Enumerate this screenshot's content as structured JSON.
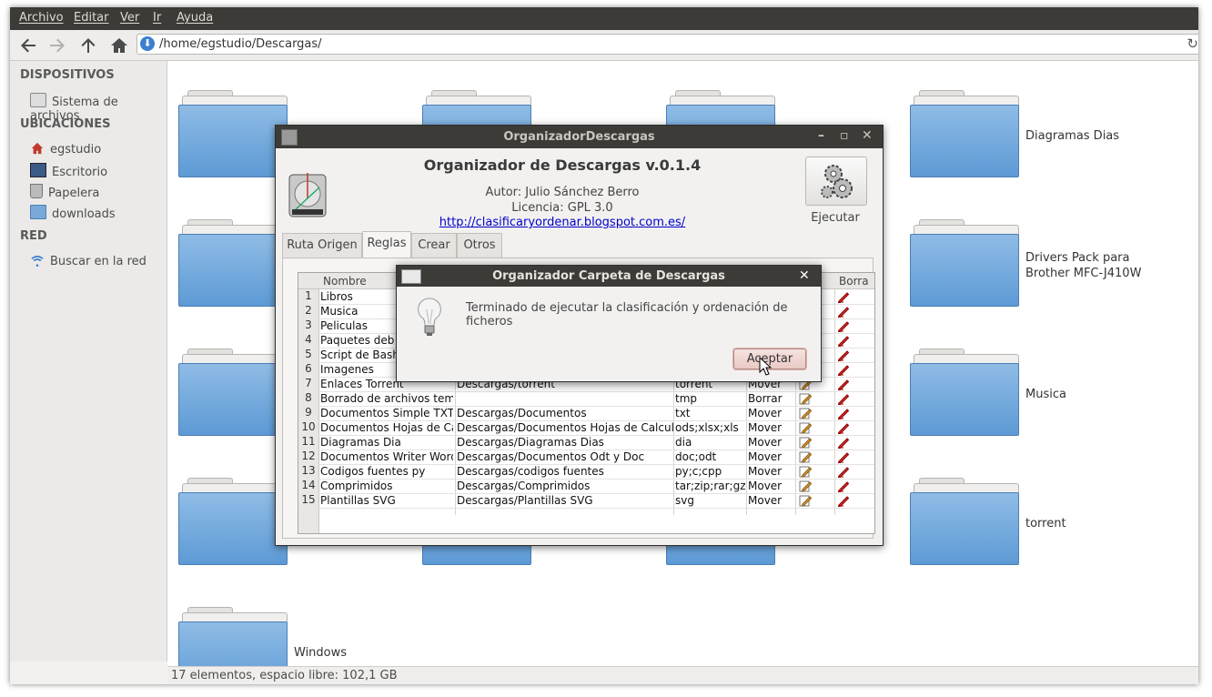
{
  "menubar": [
    "Archivo",
    "Editar",
    "Ver",
    "Ir",
    "Ayuda"
  ],
  "toolbar": {
    "path": "/home/egstudio/Descargas/"
  },
  "sidebar": {
    "dispositivos": "DISPOSITIVOS",
    "sistema": "Sistema de archivos",
    "ubicaciones": "UBICACIONES",
    "items": [
      "egstudio",
      "Escritorio",
      "Papelera",
      "downloads"
    ],
    "red": "RED",
    "buscar": "Buscar en la red"
  },
  "folders": {
    "diagramas": "Diagramas Dias",
    "drivers": "Drivers Pack para Brother MFC-J410W",
    "musica": "Musica",
    "torrent": "torrent",
    "windows": "Windows"
  },
  "status": "17 elementos, espacio libre: 102,1 GB",
  "app": {
    "window_title": "OrganizadorDescargas",
    "heading": "Organizador de Descargas v.0.1.4",
    "author": "Autor: Julio Sánchez Berro",
    "license": "Licencia: GPL 3.0",
    "url": "http://clasificaryordenar.blogspot.com.es/",
    "run_label": "Ejecutar",
    "tabs": [
      "Ruta Origen",
      "Reglas",
      "Crear",
      "Otros"
    ],
    "columns": {
      "nombre": "Nombre",
      "borra": "Borra"
    },
    "rows": [
      {
        "n": "1",
        "name": "Libros",
        "dest": "",
        "ext": "",
        "action": ""
      },
      {
        "n": "2",
        "name": "Musica",
        "dest": "",
        "ext": "",
        "action": ""
      },
      {
        "n": "3",
        "name": "Peliculas",
        "dest": "",
        "ext": "",
        "action": ""
      },
      {
        "n": "4",
        "name": "Paquetes deb",
        "dest": "",
        "ext": "",
        "action": ""
      },
      {
        "n": "5",
        "name": "Script de Bash",
        "dest": "",
        "ext": "",
        "action": ""
      },
      {
        "n": "6",
        "name": "Imagenes",
        "dest": "",
        "ext": "",
        "action": ""
      },
      {
        "n": "7",
        "name": "Enlaces Torrent",
        "dest": "Descargas/torrent",
        "ext": "torrent",
        "action": "Mover"
      },
      {
        "n": "8",
        "name": "Borrado de archivos tempor",
        "dest": "",
        "ext": "tmp",
        "action": "Borrar"
      },
      {
        "n": "9",
        "name": "Documentos Simple TXT",
        "dest": "Descargas/Documentos",
        "ext": "txt",
        "action": "Mover"
      },
      {
        "n": "10",
        "name": "Documentos Hojas de Calcu",
        "dest": "Descargas/Documentos Hojas de Calculo",
        "ext": "ods;xlsx;xls",
        "action": "Mover"
      },
      {
        "n": "11",
        "name": "Diagramas Dia",
        "dest": "Descargas/Diagramas Dias",
        "ext": "dia",
        "action": "Mover"
      },
      {
        "n": "12",
        "name": "Documentos Writer Word",
        "dest": "Descargas/Documentos Odt y Doc",
        "ext": "doc;odt",
        "action": "Mover"
      },
      {
        "n": "13",
        "name": "Codigos fuentes py",
        "dest": "Descargas/codigos fuentes",
        "ext": "py;c;cpp",
        "action": "Mover"
      },
      {
        "n": "14",
        "name": "Comprimidos",
        "dest": "Descargas/Comprimidos",
        "ext": "tar;zip;rar;gz",
        "action": "Mover"
      },
      {
        "n": "15",
        "name": "Plantillas SVG",
        "dest": "Descargas/Plantillas SVG",
        "ext": "svg",
        "action": "Mover"
      }
    ]
  },
  "dialog": {
    "title": "Organizador Carpeta de Descargas",
    "message": "Terminado de ejecutar la clasificación y ordenación de ficheros",
    "button": "Aceptar"
  },
  "colors": {
    "titlebar": "#3c3b37",
    "folder": "#5d9ad5",
    "link": "#0000cc"
  }
}
